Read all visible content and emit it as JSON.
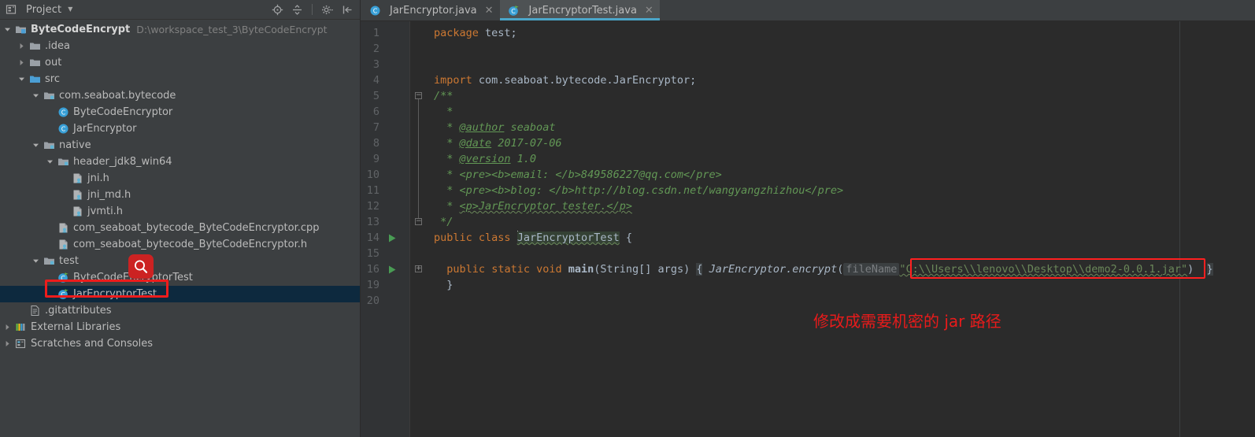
{
  "sidebar": {
    "header": {
      "title": "Project",
      "caret_icon": "chevron-down-icon",
      "tools": [
        {
          "name": "locate-icon",
          "label": "Select Opened File"
        },
        {
          "name": "collapse-all-icon",
          "label": "Collapse All"
        },
        {
          "name": "gear-icon",
          "label": "Settings"
        },
        {
          "name": "hide-panel-icon",
          "label": "Hide"
        }
      ]
    },
    "tree": [
      {
        "label": "ByteCodeEncrypt",
        "path": "D:\\workspace_test_3\\ByteCodeEncrypt",
        "indent": 0,
        "arrow": "down",
        "icon": "project-module-icon",
        "bold": true,
        "selected": false
      },
      {
        "label": ".idea",
        "path": "",
        "indent": 1,
        "arrow": "right",
        "icon": "folder-icon",
        "bold": false,
        "selected": false
      },
      {
        "label": "out",
        "path": "",
        "indent": 1,
        "arrow": "right",
        "icon": "folder-icon",
        "bold": false,
        "selected": false
      },
      {
        "label": "src",
        "path": "",
        "indent": 1,
        "arrow": "down",
        "icon": "source-folder-icon",
        "bold": false,
        "selected": false
      },
      {
        "label": "com.seaboat.bytecode",
        "path": "",
        "indent": 2,
        "arrow": "down",
        "icon": "package-icon",
        "bold": false,
        "selected": false
      },
      {
        "label": "ByteCodeEncryptor",
        "path": "",
        "indent": 3,
        "arrow": "none",
        "icon": "java-class-icon",
        "bold": false,
        "selected": false
      },
      {
        "label": "JarEncryptor",
        "path": "",
        "indent": 3,
        "arrow": "none",
        "icon": "java-class-icon",
        "bold": false,
        "selected": false
      },
      {
        "label": "native",
        "path": "",
        "indent": 2,
        "arrow": "down",
        "icon": "package-icon",
        "bold": false,
        "selected": false
      },
      {
        "label": "header_jdk8_win64",
        "path": "",
        "indent": 3,
        "arrow": "down",
        "icon": "package-icon",
        "bold": false,
        "selected": false
      },
      {
        "label": "jni.h",
        "path": "",
        "indent": 4,
        "arrow": "none",
        "icon": "c-header-file-icon",
        "bold": false,
        "selected": false
      },
      {
        "label": "jni_md.h",
        "path": "",
        "indent": 4,
        "arrow": "none",
        "icon": "c-header-file-icon",
        "bold": false,
        "selected": false
      },
      {
        "label": "jvmti.h",
        "path": "",
        "indent": 4,
        "arrow": "none",
        "icon": "c-header-file-icon",
        "bold": false,
        "selected": false
      },
      {
        "label": "com_seaboat_bytecode_ByteCodeEncryptor.cpp",
        "path": "",
        "indent": 3,
        "arrow": "none",
        "icon": "c-header-file-icon",
        "bold": false,
        "selected": false
      },
      {
        "label": "com_seaboat_bytecode_ByteCodeEncryptor.h",
        "path": "",
        "indent": 3,
        "arrow": "none",
        "icon": "c-header-file-icon",
        "bold": false,
        "selected": false
      },
      {
        "label": "test",
        "path": "",
        "indent": 2,
        "arrow": "down",
        "icon": "package-icon",
        "bold": false,
        "selected": false
      },
      {
        "label": "ByteCodeEncryptorTest",
        "path": "",
        "indent": 3,
        "arrow": "none",
        "icon": "java-test-class-icon",
        "bold": false,
        "selected": false
      },
      {
        "label": "JarEncryptorTest",
        "path": "",
        "indent": 3,
        "arrow": "none",
        "icon": "java-test-class-icon",
        "bold": false,
        "selected": true
      },
      {
        "label": ".gitattributes",
        "path": "",
        "indent": 1,
        "arrow": "none",
        "icon": "text-file-icon",
        "bold": false,
        "selected": false
      },
      {
        "label": "External Libraries",
        "path": "",
        "indent": 0,
        "arrow": "right",
        "icon": "libraries-icon",
        "bold": false,
        "selected": false
      },
      {
        "label": "Scratches and Consoles",
        "path": "",
        "indent": 0,
        "arrow": "right",
        "icon": "scratches-icon",
        "bold": false,
        "selected": false
      }
    ]
  },
  "editor": {
    "tabs": [
      {
        "label": "JarEncryptor.java",
        "icon": "java-class-icon",
        "active": false,
        "close_icon": "close-icon"
      },
      {
        "label": "JarEncryptorTest.java",
        "icon": "java-test-class-icon",
        "active": true,
        "close_icon": "close-icon"
      }
    ],
    "line_numbers": [
      "1",
      "2",
      "3",
      "4",
      "5",
      "6",
      "7",
      "8",
      "9",
      "10",
      "11",
      "12",
      "13",
      "14",
      "15",
      "16",
      "19",
      "20"
    ],
    "run_arrow_lines": [
      "14",
      "16"
    ],
    "code": {
      "l1_kw": "package",
      "l1_rest": " test;",
      "l4_kw": "import",
      "l4_rest": " com.seaboat.bytecode.JarEncryptor;",
      "l5": "/**",
      "l6": "*",
      "l7_tag": "@author",
      "l7_rest": " seaboat",
      "l8_tag": "@date",
      "l8_rest": " 2017-07-06",
      "l9_tag": "@version",
      "l9_rest": " 1.0",
      "l10": "<pre><b>email: </b>849586227@qq.com</pre>",
      "l11": "<pre><b>blog: </b>http://blog.csdn.net/wangyangzhizhou</pre>",
      "l12": "<p>JarEncryptor tester.</p>",
      "l13": "*/",
      "l14_kw1": "public",
      "l14_kw2": "class",
      "l14_name": "JarEncryptorTest",
      "l14_brace": "{",
      "l16_kw1": "public",
      "l16_kw2": "static",
      "l16_kw3": "void",
      "l16_main": "main",
      "l16_args": "(String[] args)",
      "l16_brace": "{",
      "l16_call_obj": "JarEncryptor.",
      "l16_call_m": "encrypt",
      "l16_paren": "(",
      "l16_hint": "fileName",
      "l16_string": "\"C:\\\\Users\\\\lenovo\\\\Desktop\\\\demo2-0.0.1.jar\"",
      "l16_closeparen": ")",
      "l16_endbrace": "}",
      "l19": "}"
    },
    "annotation": {
      "text": "修改成需要机密的 jar 路径",
      "color": "#e81b1b"
    }
  },
  "colors": {
    "accent": "#4ba6c9",
    "selection": "#0d293e",
    "annotation_red": "#ee1c1c",
    "editor_bg": "#2b2b2b",
    "panel_bg": "#3c3f41",
    "keyword": "#cc7832",
    "comment": "#629755",
    "string": "#6a8759"
  }
}
